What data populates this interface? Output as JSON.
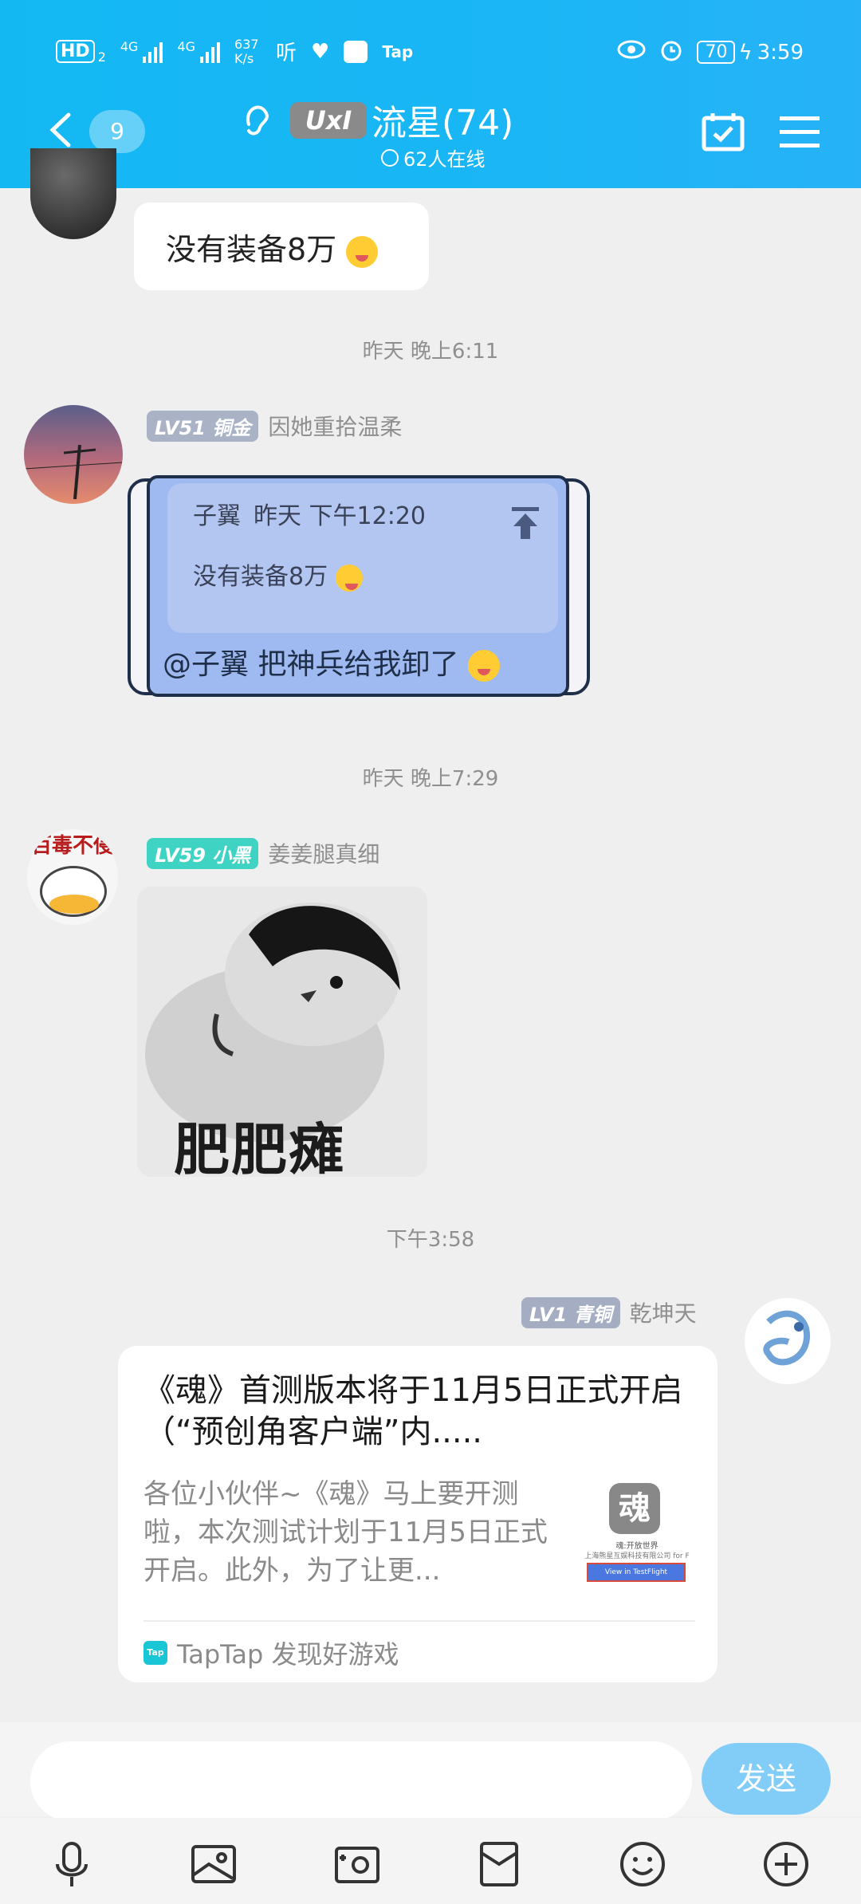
{
  "status_bar": {
    "hd": "HD",
    "sim1": "2",
    "net1": "4G",
    "net2": "4G",
    "speed": "637 K/s",
    "app1": "听",
    "app3": "Tap",
    "battery": "70",
    "time": "3:59"
  },
  "header": {
    "unread_count": "9",
    "group_logo": "UxI",
    "group_title": "流星(74)",
    "online": "62人在线"
  },
  "messages": {
    "m1": {
      "text": "没有装备8万"
    },
    "ts1": "昨天 晚上6:11",
    "m2": {
      "level": "LV51",
      "title": "铜金",
      "username": "因她重拾温柔",
      "quote_author": "子翼",
      "quote_time": "昨天 下午12:20",
      "quote_text": "没有装备8万",
      "text": "@子翼 把神兵给我卸了"
    },
    "ts2": "昨天 晚上7:29",
    "m3": {
      "level": "LV59",
      "title": "小黑",
      "username": "姜姜腿真细",
      "avatar_text": "百毒不侵",
      "sticker_caption": "肥肥瘫"
    },
    "ts3": "下午3:58",
    "m4": {
      "level": "LV1",
      "title": "青铜",
      "username": "乾坤天",
      "card_title": "《魂》首测版本将于11月5日正式开启（“预创角客户端”内.....",
      "card_desc": "各位小伙伴~《魂》马上要开测啦，本次测试计划于11月5日正式开启。此外，为了让更...",
      "thumb_logo": "魂",
      "thumb_line1": "魂:开放世界",
      "thumb_line2": "上海熊星互娱科技有限公司 for F",
      "thumb_btn": "View in TestFlight",
      "source_icon": "Tap",
      "source": "TapTap 发现好游戏"
    }
  },
  "composer": {
    "send_label": "发送"
  },
  "colors": {
    "header": "#19b6f4",
    "send": "#82cdf8",
    "lv51": "#aab2c6",
    "lv59": "#3fd3c4",
    "lv1": "#a4adc2"
  }
}
